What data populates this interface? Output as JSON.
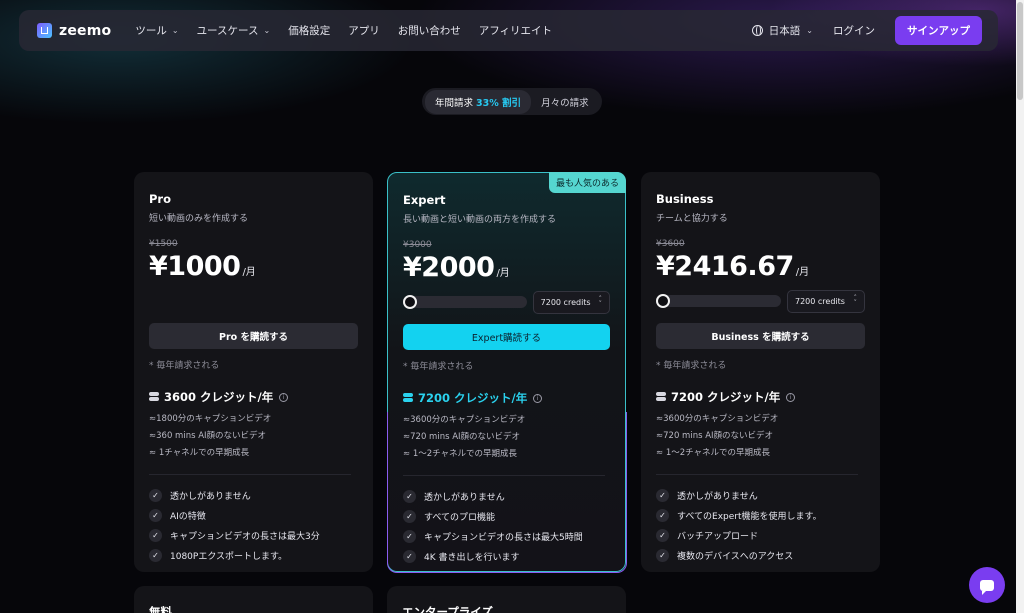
{
  "brand": {
    "name": "zeemo"
  },
  "nav": {
    "menu": [
      {
        "label": "ツール",
        "dropdown": true
      },
      {
        "label": "ユースケース",
        "dropdown": true
      },
      {
        "label": "価格設定",
        "dropdown": false
      },
      {
        "label": "アプリ",
        "dropdown": false
      },
      {
        "label": "お問い合わせ",
        "dropdown": false
      },
      {
        "label": "アフィリエイト",
        "dropdown": false
      }
    ],
    "language": "日本語",
    "login": "ログイン",
    "signup": "サインアップ"
  },
  "billing_toggle": {
    "yearly": "年間請求",
    "discount": "33% 割引",
    "monthly": "月々の請求"
  },
  "plans": {
    "pro": {
      "name": "Pro",
      "desc": "短い動画のみを作成する",
      "old_price": "¥1500",
      "price": "¥1000",
      "per": "/月",
      "button": "Pro を購読する",
      "billing_note": "* 毎年請求される",
      "credits": "3600 クレジット/年",
      "details": [
        "≈1800分のキャプションビデオ",
        "≈360 mins AI顔のないビデオ",
        "≈ 1チャネルでの早期成長"
      ],
      "features": [
        "透かしがありません",
        "AIの特徴",
        "キャプションビデオの長さは最大3分",
        "1080Pエクスポートします。"
      ]
    },
    "expert": {
      "badge": "最も人気のある",
      "name": "Expert",
      "desc": "長い動画と短い動画の両方を作成する",
      "old_price": "¥3000",
      "price": "¥2000",
      "per": "/月",
      "credit_select": "7200 credits",
      "credit_fraction": 0,
      "button": "Expert購読する",
      "billing_note": "* 毎年請求される",
      "credits": "7200 クレジット/年",
      "details": [
        "≈3600分のキャプションビデオ",
        "≈720 mins AI顔のないビデオ",
        "≈ 1〜2チャネルでの早期成長"
      ],
      "features": [
        "透かしがありません",
        "すべてのプロ機能",
        "キャプションビデオの長さは最大5時間",
        "4K 書き出しを行います"
      ]
    },
    "business": {
      "name": "Business",
      "desc": "チームと協力する",
      "old_price": "¥3600",
      "price": "¥2416.67",
      "per": "/月",
      "credit_select": "7200 credits",
      "credit_fraction": 0,
      "button": "Business を購読する",
      "billing_note": "* 毎年請求される",
      "credits": "7200 クレジット/年",
      "details": [
        "≈3600分のキャプションビデオ",
        "≈720 mins AI顔のないビデオ",
        "≈ 1〜2チャネルでの早期成長"
      ],
      "features": [
        "透かしがありません",
        "すべてのExpert機能を使用します。",
        "バッチアップロード",
        "複数のデバイスへのアクセス"
      ]
    },
    "free": {
      "name": "無料"
    },
    "enterprise": {
      "name": "エンタープライズ"
    }
  },
  "colors": {
    "accent_purple": "#7a3df0",
    "accent_cyan": "#13d2f0",
    "badge_teal": "#55d6d0"
  }
}
